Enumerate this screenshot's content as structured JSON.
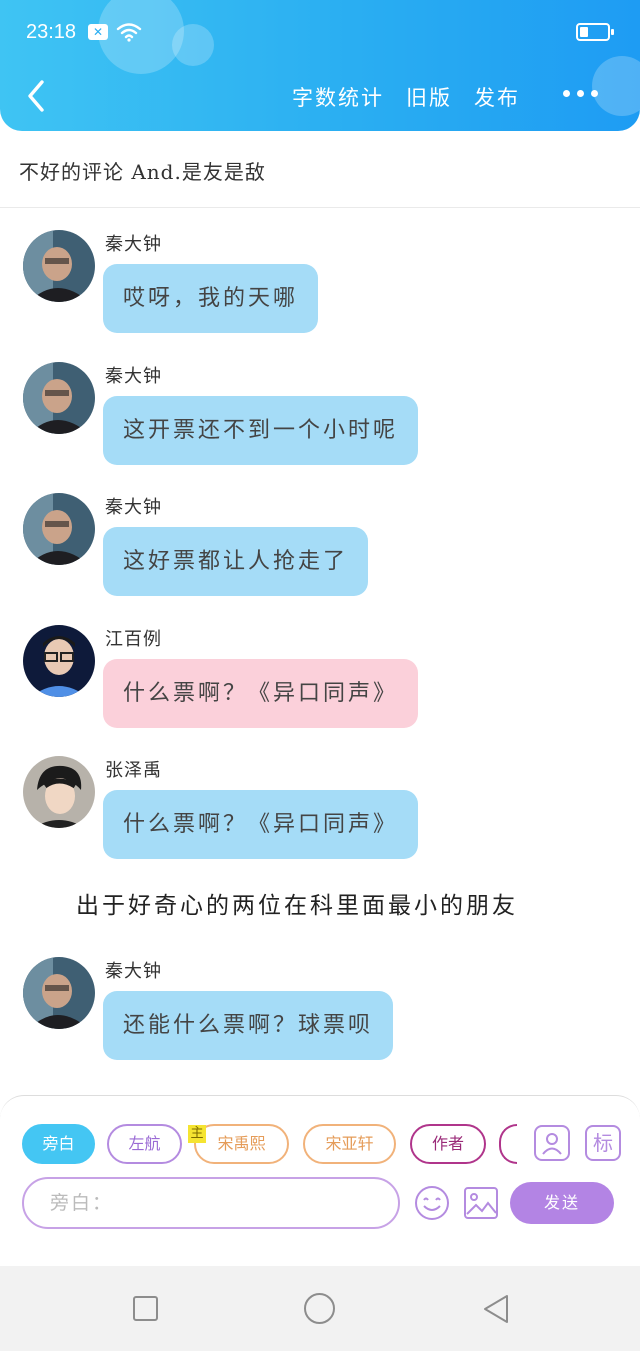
{
  "status_bar": {
    "time": "23:18"
  },
  "header": {
    "actions": [
      "字数统计",
      "旧版",
      "发布"
    ]
  },
  "title_bar": {
    "title": "不好的评论 And.是友是敌"
  },
  "messages": [
    {
      "speaker": "秦大钟",
      "text": "哎呀，我的天哪",
      "color": "blue"
    },
    {
      "speaker": "秦大钟",
      "text": "这开票还不到一个小时呢",
      "color": "blue"
    },
    {
      "speaker": "秦大钟",
      "text": "这好票都让人抢走了",
      "color": "blue"
    },
    {
      "speaker": "江百例",
      "text": "什么票啊？《异口同声》",
      "color": "pink"
    },
    {
      "speaker": "张泽禹",
      "text": "什么票啊？《异口同声》",
      "color": "blue"
    },
    {
      "speaker": "秦大钟",
      "text": "还能什么票啊？球票呗",
      "color": "blue"
    }
  ],
  "narration": "出于好奇心的两位在科里面最小的朋友",
  "roles": {
    "items": [
      "旁白",
      "左航",
      "宋禹熙",
      "宋亚轩",
      "作者"
    ],
    "active": "旁白",
    "main_tag": "主"
  },
  "composer": {
    "placeholder": "旁白：",
    "send_label": "发送",
    "tag_label": "标"
  },
  "colors": {
    "header_gradient_start": "#3fc4f3",
    "header_gradient_end": "#1e9cf3",
    "bubble_blue": "#a5dcf7",
    "bubble_pink": "#fbd0da",
    "accent_purple": "#b384e4",
    "chip_active": "#44c6f3"
  }
}
